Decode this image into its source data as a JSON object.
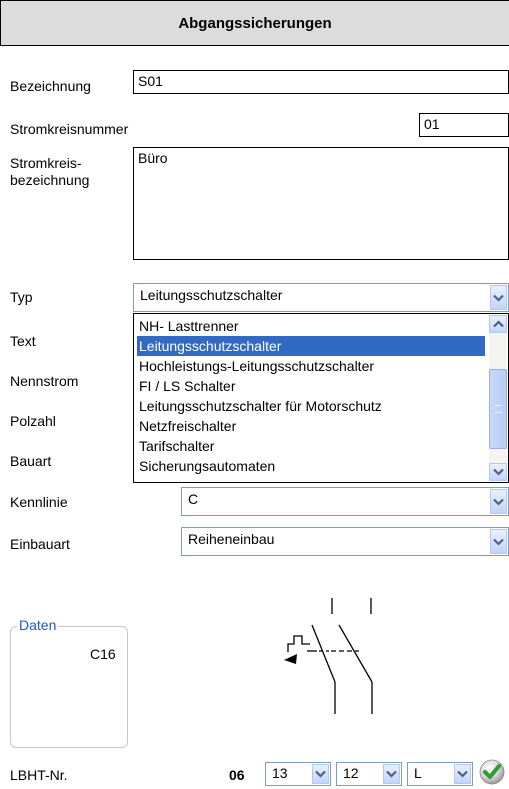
{
  "header": {
    "title": "Abgangssicherungen"
  },
  "fields": {
    "bezeichnung": {
      "label": "Bezeichnung",
      "value": "S01"
    },
    "stromkreisnummer": {
      "label": "Stromkreisnummer",
      "value": "01"
    },
    "stromkreisbezeichnung": {
      "label_line1": "Stromkreis-",
      "label_line2": "bezeichnung",
      "value": "Büro"
    },
    "typ": {
      "label": "Typ",
      "value": "Leitungsschutzschalter"
    },
    "text": {
      "label": "Text"
    },
    "nennstrom": {
      "label": "Nennstrom"
    },
    "polzahl": {
      "label": "Polzahl"
    },
    "bauart": {
      "label": "Bauart"
    },
    "kennlinie": {
      "label": "Kennlinie",
      "value": "C"
    },
    "einbauart": {
      "label": "Einbauart",
      "value": "Reiheneinbau"
    }
  },
  "typ_dropdown": {
    "options": [
      "NH- Lasttrenner",
      "Leitungsschutzschalter",
      "Hochleistungs-Leitungsschutzschalter",
      "FI / LS Schalter",
      "Leitungsschutzschalter für Motorschutz",
      "Netzfreischalter",
      "Tarifschalter",
      "Sicherungsautomaten"
    ],
    "selected_index": 1
  },
  "daten": {
    "legend": "Daten",
    "value": "C16"
  },
  "lbht": {
    "label": "LBHT-Nr.",
    "prefix": "06",
    "select1": "13",
    "select2": "12",
    "select3": "L"
  },
  "colors": {
    "selection": "#316ac5",
    "legend_text": "#2456c7",
    "header_bg": "#dcdcdc"
  },
  "icons": [
    "chevron-down-icon",
    "chevron-up-icon",
    "scroll-grip-icon",
    "checkmark-ok-icon",
    "circuit-breaker-symbol"
  ]
}
